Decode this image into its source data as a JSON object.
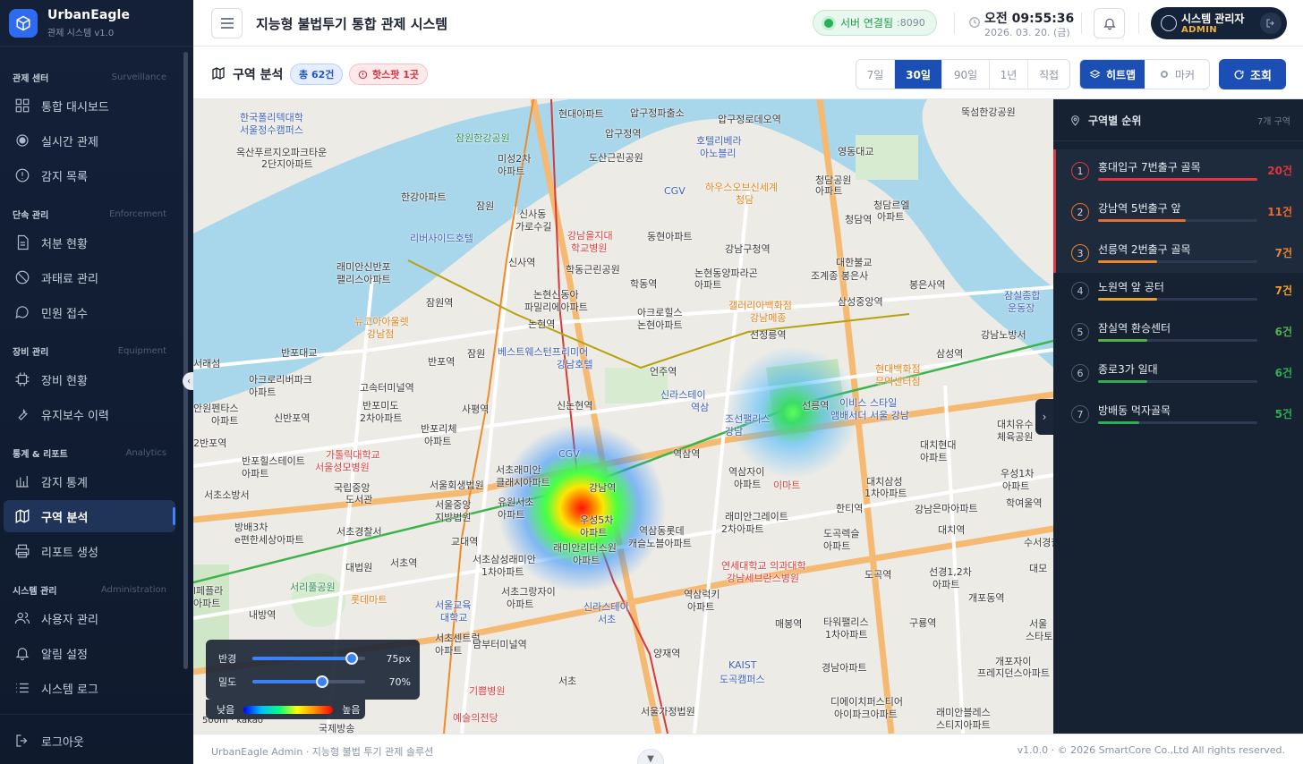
{
  "brand": {
    "name": "UrbanEagle",
    "sub": "관제 시스템 v1.0"
  },
  "sidebar": {
    "sections": [
      {
        "ko": "관제 센터",
        "en": "Surveillance",
        "items": [
          {
            "label": "통합 대시보드",
            "icon": "grid-icon"
          },
          {
            "label": "실시간 관제",
            "icon": "target-icon"
          },
          {
            "label": "감지 목록",
            "icon": "alert-circle-icon"
          }
        ]
      },
      {
        "ko": "단속 관리",
        "en": "Enforcement",
        "items": [
          {
            "label": "처분 현황",
            "icon": "document-icon"
          },
          {
            "label": "과태료 관리",
            "icon": "ban-icon"
          },
          {
            "label": "민원 접수",
            "icon": "chat-icon"
          }
        ]
      },
      {
        "ko": "장비 관리",
        "en": "Equipment",
        "items": [
          {
            "label": "장비 현황",
            "icon": "chip-icon"
          },
          {
            "label": "유지보수 이력",
            "icon": "wrench-icon"
          }
        ]
      },
      {
        "ko": "통계 & 리포트",
        "en": "Analytics",
        "items": [
          {
            "label": "감지 통계",
            "icon": "bar-chart-icon"
          },
          {
            "label": "구역 분석",
            "icon": "map-icon",
            "active": true
          },
          {
            "label": "리포트 생성",
            "icon": "printer-icon"
          }
        ]
      },
      {
        "ko": "시스템 관리",
        "en": "Administration",
        "items": [
          {
            "label": "사용자 관리",
            "icon": "users-icon"
          },
          {
            "label": "알림 설정",
            "icon": "bell-icon"
          },
          {
            "label": "시스템 로그",
            "icon": "list-icon"
          }
        ]
      }
    ],
    "logout": "로그아웃"
  },
  "header": {
    "title": "지능형 불법투기 통합 관제 시스템",
    "server_status": "서버 연결됨",
    "server_port": ":8090",
    "time": "오전 09:55:36",
    "date": "2026. 03. 20. (금)",
    "user_name": "시스템 관리자",
    "user_role": "ADMIN"
  },
  "toolbar": {
    "title": "구역 분석",
    "total_badge": "총 62건",
    "hot_badge": "핫스팟 1곳",
    "periods": [
      "7일",
      "30일",
      "90일",
      "1년",
      "직접"
    ],
    "active_period": "30일",
    "view_heatmap": "히트맵",
    "view_marker": "마커",
    "query": "조회"
  },
  "map": {
    "controls": {
      "radius_label": "반경",
      "radius_value": "75px",
      "radius_level": 0.88,
      "density_label": "밀도",
      "density_value": "70%",
      "density_level": 0.62,
      "legend_low": "낮음",
      "legend_high": "높음"
    },
    "scale_text": "500m · kakao",
    "places": [
      "한국폴리텍대학 서울정수캠퍼스",
      "잠원한강공원",
      "현대아파트",
      "압구정파출소",
      "압구정로데오역",
      "뚝섬한강공원",
      "옥산푸르지오파크타운 2단지아파트",
      "미성2차 아파트",
      "압구정역",
      "호텔리베라 아노블리",
      "영동대교",
      "도산근린공원",
      "CGV",
      "하우스오브신세계 청담",
      "청담공원 아파트",
      "한강아파트",
      "잠원",
      "신사동 가로수길",
      "강남을지대 학교병원",
      "동현아파트",
      "강남구청역",
      "청담역",
      "청담르엘 아파트",
      "리버사이드호텔",
      "신사역",
      "학동근린공원",
      "논현동양파라곤 아파트",
      "대한불교 조계종 봉은사",
      "래미안신반포 팰리스아파트",
      "잠원역",
      "논현신동아 파밀리에아파트",
      "학동역",
      "봉은사역",
      "잠실종합운동장",
      "뉴코아아울렛 강남점",
      "논현역",
      "삼성중앙역",
      "아크로힐스 논현아파트",
      "선정릉역",
      "반포대교",
      "반포역",
      "갤러리아백화점 강남",
      "강남도서관",
      "서래섬",
      "베스트웨스턴프리미어 강남호텔",
      "언주역",
      "현대백화점 무역센터점",
      "삼성역",
      "아크로리버파크 아파트",
      "고속터미널역",
      "신라스테이 역삼",
      "선릉역",
      "이비스 스타일 앰배서더 서울 강남",
      "반포미도 2차아파트",
      "사평역",
      "신논현역",
      "조선팰리스 강남",
      "신반포역",
      "반포자체 아파트",
      "가톨릭대학교 서울성모병원",
      "CGV",
      "역삼역",
      "대치현대 아파트",
      "대치유수 체육공원",
      "반포힐스테이트 아파트",
      "서초래미안 클래시아파트",
      "역삼자이 아파트",
      "이마트",
      "우성1차 아파트",
      "서초소방서",
      "국립중앙 도서관",
      "서울회생법원",
      "강남역",
      "대치삼성 1차아파트",
      "학여울역",
      "서울중앙 지방법원",
      "유원서초 아파트",
      "래미안그레이트 2차아파트",
      "한티역",
      "강남",
      "은마아파트",
      "방배3차 e편한세상아파트",
      "서초경찰서",
      "우성5차 아파트",
      "역삼동롯데 캐슬노블아파트",
      "대치역",
      "교대역",
      "래미안리더스원 아파트",
      "도곡렉슬 아파트",
      "수서경찰",
      "서초역",
      "서초삼성래미안 1차아파트",
      "연세대학교 의과대학 강남세브란스병원",
      "대법원",
      "도곡역",
      "선경1,2차 아파트",
      "서리풀공원",
      "방배롯데",
      "서초그랑자이 아파트",
      "역삼럭키 아파트",
      "개포동역",
      "롯데마트",
      "서울교육 대학교",
      "신라스테이 서초",
      "내방역",
      "매봉역",
      "구룡역",
      "타워팰리스 1차아파트",
      "서초센트럴 아파트",
      "남부터미널역",
      "양재역",
      "경남아파트",
      "개포자이 프레지던스아파트",
      "KAIST 도곡캠퍼스",
      "서초",
      "기쁨병원",
      "예술의전당",
      "디에이치퍼스티어 아이파크아파트",
      "래미안블레스 스티지아파트",
      "서울가정법원",
      "국제방송"
    ]
  },
  "ranking": {
    "title": "구역별 순위",
    "count": "7개 구역",
    "items": [
      {
        "rank": "1",
        "name": "홍대입구 7번출구 골목",
        "count": "20건",
        "level": 1.0,
        "color": "#e0353f",
        "hot": true
      },
      {
        "rank": "2",
        "name": "강남역 5번출구 앞",
        "count": "11건",
        "level": 0.55,
        "color": "#f06a2b",
        "hot": true
      },
      {
        "rank": "3",
        "name": "선릉역 2번출구 골목",
        "count": "7건",
        "level": 0.37,
        "color": "#f0842b",
        "hot": true
      },
      {
        "rank": "4",
        "name": "노원역 앞 공터",
        "count": "7건",
        "level": 0.37,
        "color": "#f0a02b",
        "hot": false
      },
      {
        "rank": "5",
        "name": "잠실역 환승센터",
        "count": "6건",
        "level": 0.31,
        "color": "#53b04a",
        "hot": false
      },
      {
        "rank": "6",
        "name": "종로3가 일대",
        "count": "6건",
        "level": 0.31,
        "color": "#2fae52",
        "hot": false
      },
      {
        "rank": "7",
        "name": "방배동 먹자골목",
        "count": "5건",
        "level": 0.26,
        "color": "#2fae52",
        "hot": false
      }
    ],
    "colors": {
      "hot": "#e0353f",
      "orange": "#f0842b",
      "yellow": "#f0a02b",
      "green": "#2fae52"
    }
  },
  "footer": {
    "left": "UrbanEagle Admin · 지능형 불법 투기 관제 솔루션",
    "right": "v1.0.0 · © 2026 SmartCore Co.,Ltd All rights reserved."
  }
}
